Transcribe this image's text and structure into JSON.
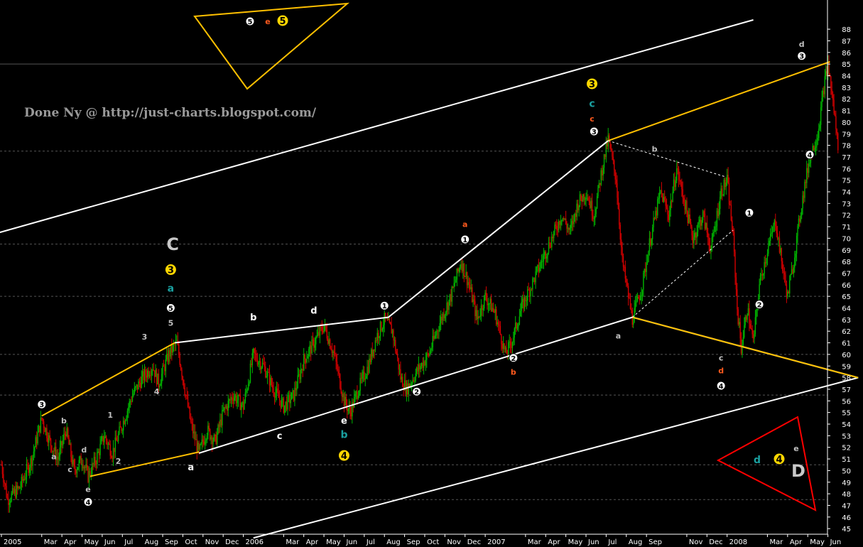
{
  "chart_data": {
    "type": "candlestick",
    "title": "",
    "xlabel": "",
    "ylabel": "",
    "ylim": [
      44,
      89
    ],
    "grid": false,
    "y_ticks": [
      45,
      46,
      47,
      48,
      49,
      50,
      51,
      52,
      53,
      54,
      55,
      56,
      57,
      58,
      59,
      60,
      61,
      62,
      63,
      64,
      65,
      66,
      67,
      68,
      69,
      70,
      71,
      72,
      73,
      74,
      75,
      76,
      77,
      78,
      79,
      80,
      81,
      82,
      83,
      84,
      85,
      86,
      87,
      88
    ],
    "x_labels": [
      {
        "label": "2005",
        "t": 0
      },
      {
        "label": "Mar",
        "t": 2
      },
      {
        "label": "Apr",
        "t": 3
      },
      {
        "label": "May",
        "t": 4
      },
      {
        "label": "Jun",
        "t": 5
      },
      {
        "label": "Jul",
        "t": 6
      },
      {
        "label": "Aug",
        "t": 7
      },
      {
        "label": "Sep",
        "t": 8
      },
      {
        "label": "Oct",
        "t": 9
      },
      {
        "label": "Nov",
        "t": 10
      },
      {
        "label": "Dec",
        "t": 11
      },
      {
        "label": "2006",
        "t": 12
      },
      {
        "label": "Mar",
        "t": 14
      },
      {
        "label": "Apr",
        "t": 15
      },
      {
        "label": "May",
        "t": 16
      },
      {
        "label": "Jun",
        "t": 17
      },
      {
        "label": "Jul",
        "t": 18
      },
      {
        "label": "Aug",
        "t": 19
      },
      {
        "label": "Sep",
        "t": 20
      },
      {
        "label": "Oct",
        "t": 21
      },
      {
        "label": "Nov",
        "t": 22
      },
      {
        "label": "Dec",
        "t": 23
      },
      {
        "label": "2007",
        "t": 24
      },
      {
        "label": "Mar",
        "t": 26
      },
      {
        "label": "Apr",
        "t": 27
      },
      {
        "label": "May",
        "t": 28
      },
      {
        "label": "Jun",
        "t": 29
      },
      {
        "label": "Jul",
        "t": 30
      },
      {
        "label": "Aug",
        "t": 31
      },
      {
        "label": "Sep",
        "t": 32
      },
      {
        "label": "Nov",
        "t": 34
      },
      {
        "label": "Dec",
        "t": 35
      },
      {
        "label": "2008",
        "t": 36
      },
      {
        "label": "Mar",
        "t": 38
      },
      {
        "label": "Apr",
        "t": 39
      },
      {
        "label": "May",
        "t": 40
      },
      {
        "label": "Jun",
        "t": 41
      }
    ],
    "price_path": [
      {
        "t": 0,
        "v": 50.5
      },
      {
        "t": 0.3,
        "v": 47.5
      },
      {
        "t": 0.9,
        "v": 48.5
      },
      {
        "t": 1.5,
        "v": 51
      },
      {
        "t": 2,
        "v": 54.5
      },
      {
        "t": 2.4,
        "v": 52.5
      },
      {
        "t": 2.8,
        "v": 51
      },
      {
        "t": 3.2,
        "v": 53.5
      },
      {
        "t": 3.6,
        "v": 50
      },
      {
        "t": 4,
        "v": 51
      },
      {
        "t": 4.3,
        "v": 49.5
      },
      {
        "t": 4.7,
        "v": 51
      },
      {
        "t": 5.1,
        "v": 53
      },
      {
        "t": 5.5,
        "v": 51.5
      },
      {
        "t": 6,
        "v": 54
      },
      {
        "t": 6.5,
        "v": 56.5
      },
      {
        "t": 7,
        "v": 58
      },
      {
        "t": 7.5,
        "v": 59
      },
      {
        "t": 7.8,
        "v": 57.5
      },
      {
        "t": 8.3,
        "v": 60
      },
      {
        "t": 8.7,
        "v": 61
      },
      {
        "t": 9,
        "v": 58
      },
      {
        "t": 9.4,
        "v": 54
      },
      {
        "t": 9.8,
        "v": 51.5
      },
      {
        "t": 10.2,
        "v": 53.5
      },
      {
        "t": 10.6,
        "v": 52.5
      },
      {
        "t": 11,
        "v": 55
      },
      {
        "t": 11.5,
        "v": 56.5
      },
      {
        "t": 12,
        "v": 55.5
      },
      {
        "t": 12.5,
        "v": 60
      },
      {
        "t": 13,
        "v": 59
      },
      {
        "t": 13.5,
        "v": 57
      },
      {
        "t": 14,
        "v": 55.5
      },
      {
        "t": 14.5,
        "v": 56.5
      },
      {
        "t": 15,
        "v": 59.5
      },
      {
        "t": 15.5,
        "v": 61
      },
      {
        "t": 16,
        "v": 62.5
      },
      {
        "t": 16.5,
        "v": 60
      },
      {
        "t": 17,
        "v": 56
      },
      {
        "t": 17.3,
        "v": 55
      },
      {
        "t": 17.7,
        "v": 57
      },
      {
        "t": 18.2,
        "v": 59
      },
      {
        "t": 18.6,
        "v": 61.5
      },
      {
        "t": 19,
        "v": 63
      },
      {
        "t": 19.4,
        "v": 62
      },
      {
        "t": 19.8,
        "v": 58
      },
      {
        "t": 20.1,
        "v": 57
      },
      {
        "t": 20.6,
        "v": 58.5
      },
      {
        "t": 21.2,
        "v": 60
      },
      {
        "t": 21.8,
        "v": 63
      },
      {
        "t": 22.3,
        "v": 65
      },
      {
        "t": 22.8,
        "v": 68
      },
      {
        "t": 23.2,
        "v": 66
      },
      {
        "t": 23.6,
        "v": 63
      },
      {
        "t": 24,
        "v": 65
      },
      {
        "t": 24.5,
        "v": 63.5
      },
      {
        "t": 25,
        "v": 60
      },
      {
        "t": 25.3,
        "v": 61
      },
      {
        "t": 25.8,
        "v": 64
      },
      {
        "t": 26.3,
        "v": 66
      },
      {
        "t": 26.8,
        "v": 68
      },
      {
        "t": 27.3,
        "v": 70
      },
      {
        "t": 27.8,
        "v": 72
      },
      {
        "t": 28.2,
        "v": 70.5
      },
      {
        "t": 28.6,
        "v": 73
      },
      {
        "t": 29,
        "v": 74
      },
      {
        "t": 29.4,
        "v": 72
      },
      {
        "t": 29.8,
        "v": 76
      },
      {
        "t": 30.1,
        "v": 78.5
      },
      {
        "t": 30.5,
        "v": 75
      },
      {
        "t": 30.8,
        "v": 68
      },
      {
        "t": 31.1,
        "v": 65
      },
      {
        "t": 31.3,
        "v": 63
      },
      {
        "t": 31.8,
        "v": 66
      },
      {
        "t": 32.2,
        "v": 70
      },
      {
        "t": 32.7,
        "v": 74
      },
      {
        "t": 33.1,
        "v": 72
      },
      {
        "t": 33.5,
        "v": 76
      },
      {
        "t": 33.9,
        "v": 73
      },
      {
        "t": 34.3,
        "v": 70
      },
      {
        "t": 34.8,
        "v": 72
      },
      {
        "t": 35.2,
        "v": 69
      },
      {
        "t": 35.7,
        "v": 74
      },
      {
        "t": 36,
        "v": 75
      },
      {
        "t": 36.3,
        "v": 70
      },
      {
        "t": 36.5,
        "v": 64
      },
      {
        "t": 36.7,
        "v": 60.5
      },
      {
        "t": 37,
        "v": 64
      },
      {
        "t": 37.3,
        "v": 61
      },
      {
        "t": 37.6,
        "v": 66
      },
      {
        "t": 38,
        "v": 69
      },
      {
        "t": 38.4,
        "v": 71.5
      },
      {
        "t": 38.7,
        "v": 68
      },
      {
        "t": 39,
        "v": 65
      },
      {
        "t": 39.3,
        "v": 68
      },
      {
        "t": 39.7,
        "v": 73
      },
      {
        "t": 40.1,
        "v": 77
      },
      {
        "t": 40.5,
        "v": 79
      },
      {
        "t": 40.8,
        "v": 83
      },
      {
        "t": 41,
        "v": 85
      },
      {
        "t": 41.3,
        "v": 81
      },
      {
        "t": 41.5,
        "v": 78
      }
    ],
    "horizontal_levels": [
      47.5,
      50.5,
      56.5,
      60,
      65,
      69.5,
      77.5,
      85
    ],
    "overlay_lines": [
      {
        "name": "upper-channel",
        "color": "#ffffff",
        "pts": [
          [
            -0.5,
            70.3
          ],
          [
            37.3,
            88.8
          ]
        ]
      },
      {
        "name": "lower-channel",
        "color": "#ffffff",
        "pts": [
          [
            12.5,
            44.2
          ],
          [
            42.5,
            58
          ]
        ]
      },
      {
        "name": "mid-channel",
        "color": "#ffffff",
        "pts": [
          [
            9.8,
            51.5
          ],
          [
            31.3,
            63.2
          ],
          [
            42.5,
            58
          ]
        ]
      },
      {
        "name": "wave-c-top",
        "color": "#ffffff",
        "pts": [
          [
            8.6,
            61
          ],
          [
            19.2,
            63.2
          ],
          [
            30.1,
            78.4
          ]
        ]
      },
      {
        "name": "yellow-upper",
        "color": "#ffc000",
        "pts": [
          [
            2,
            54.7
          ],
          [
            8.6,
            61
          ]
        ]
      },
      {
        "name": "yellow-lower",
        "color": "#ffc000",
        "pts": [
          [
            4.4,
            49.5
          ],
          [
            9.8,
            51.6
          ]
        ]
      },
      {
        "name": "yellow-top",
        "color": "#ffc000",
        "pts": [
          [
            30.1,
            78.4
          ],
          [
            41.1,
            85.2
          ]
        ]
      },
      {
        "name": "yellow-bottom",
        "color": "#ffc000",
        "pts": [
          [
            31.3,
            63.2
          ],
          [
            42.5,
            58
          ]
        ]
      }
    ],
    "dashed_lines": [
      {
        "name": "b-d-dashed",
        "color": "#ffffff",
        "pts": [
          [
            30.1,
            78.4
          ],
          [
            35.9,
            75.3
          ]
        ]
      },
      {
        "name": "a-c-dashed",
        "color": "#ffffff",
        "pts": [
          [
            31.3,
            63.2
          ],
          [
            36.3,
            70.7
          ]
        ]
      }
    ],
    "wave_labels": [
      {
        "text": "3",
        "circle": true,
        "fill": "#ffffff",
        "t": 2,
        "v": 55.7
      },
      {
        "text": "b",
        "t": 3.1,
        "v": 54.3,
        "color": "#c0c0c0"
      },
      {
        "text": "a",
        "t": 2.6,
        "v": 51.2,
        "color": "#c0c0c0"
      },
      {
        "text": "c",
        "t": 3.4,
        "v": 50.1,
        "color": "#c0c0c0"
      },
      {
        "text": "d",
        "t": 4.1,
        "v": 51.8,
        "color": "#c0c0c0"
      },
      {
        "text": "e",
        "t": 4.3,
        "v": 48.4,
        "color": "#c0c0c0"
      },
      {
        "text": "4",
        "circle": true,
        "fill": "#ffffff",
        "t": 4.3,
        "v": 47.3
      },
      {
        "text": "1",
        "t": 5.4,
        "v": 54.8,
        "color": "#c0c0c0"
      },
      {
        "text": "2",
        "t": 5.8,
        "v": 50.8,
        "color": "#c0c0c0"
      },
      {
        "text": "3",
        "t": 7.1,
        "v": 61.5,
        "color": "#c0c0c0"
      },
      {
        "text": "4",
        "t": 7.7,
        "v": 56.8,
        "color": "#c0c0c0"
      },
      {
        "text": "5",
        "t": 8.4,
        "v": 62.7,
        "color": "#c0c0c0"
      },
      {
        "text": "5",
        "circle": true,
        "fill": "#ffffff",
        "t": 8.4,
        "v": 64
      },
      {
        "text": "a",
        "t": 8.4,
        "v": 65.7,
        "color": "#1aa0a0",
        "size": 14
      },
      {
        "text": "3",
        "circle": true,
        "fill": "#ffd700",
        "t": 8.4,
        "v": 67.3,
        "big": true
      },
      {
        "text": "C",
        "t": 8.5,
        "v": 69.5,
        "color": "#c8c8c8",
        "size": 24
      },
      {
        "text": "a",
        "t": 9.4,
        "v": 50.3,
        "color": "#ffffff",
        "size": 13
      },
      {
        "text": "b",
        "t": 12.5,
        "v": 63.2,
        "color": "#ffffff",
        "size": 13
      },
      {
        "text": "c",
        "t": 13.8,
        "v": 53,
        "color": "#ffffff",
        "size": 13
      },
      {
        "text": "d",
        "t": 15.5,
        "v": 63.8,
        "color": "#ffffff",
        "size": 13
      },
      {
        "text": "e",
        "t": 17,
        "v": 54.3,
        "color": "#ffffff",
        "size": 13
      },
      {
        "text": "b",
        "t": 17,
        "v": 53.1,
        "color": "#1aa0a0",
        "size": 14
      },
      {
        "text": "4",
        "circle": true,
        "fill": "#ffd700",
        "t": 17,
        "v": 51.3,
        "big": true
      },
      {
        "text": "1",
        "circle": true,
        "fill": "#ffffff",
        "t": 19,
        "v": 64.2
      },
      {
        "text": "2",
        "circle": true,
        "fill": "#ffffff",
        "t": 20.6,
        "v": 56.8
      },
      {
        "text": "a",
        "t": 23,
        "v": 71.2,
        "color": "#ff5a1e",
        "size": 11
      },
      {
        "text": "1",
        "circle": true,
        "fill": "#ffffff",
        "t": 23,
        "v": 69.9
      },
      {
        "text": "2",
        "circle": true,
        "fill": "#ffffff",
        "t": 25.4,
        "v": 59.7
      },
      {
        "text": "b",
        "t": 25.4,
        "v": 58.5,
        "color": "#ff5a1e",
        "size": 11
      },
      {
        "text": "3",
        "circle": true,
        "fill": "#ffd700",
        "t": 29.3,
        "v": 83.3,
        "big": true
      },
      {
        "text": "c",
        "t": 29.3,
        "v": 81.6,
        "color": "#1aa0a0",
        "size": 14
      },
      {
        "text": "c",
        "t": 29.3,
        "v": 80.3,
        "color": "#ff5a1e",
        "size": 11
      },
      {
        "text": "3",
        "circle": true,
        "fill": "#ffffff",
        "t": 29.4,
        "v": 79.2
      },
      {
        "text": "b",
        "t": 32.4,
        "v": 77.7,
        "color": "#c0c0c0"
      },
      {
        "text": "a",
        "t": 30.6,
        "v": 61.6,
        "color": "#c0c0c0"
      },
      {
        "text": "c",
        "t": 35.7,
        "v": 59.7,
        "color": "#c0c0c0"
      },
      {
        "text": "d",
        "t": 35.7,
        "v": 58.6,
        "color": "#ff5a1e",
        "size": 11
      },
      {
        "text": "4",
        "circle": true,
        "fill": "#ffffff",
        "t": 35.7,
        "v": 57.3
      },
      {
        "text": "1",
        "circle": true,
        "fill": "#ffffff",
        "t": 37.1,
        "v": 72.2
      },
      {
        "text": "2",
        "circle": true,
        "fill": "#ffffff",
        "t": 37.6,
        "v": 64.3
      },
      {
        "text": "d",
        "t": 39.7,
        "v": 86.7,
        "color": "#c0c0c0"
      },
      {
        "text": "3",
        "circle": true,
        "fill": "#ffffff",
        "t": 39.7,
        "v": 85.7
      },
      {
        "text": "4",
        "circle": true,
        "fill": "#ffffff",
        "t": 40.1,
        "v": 77.2
      }
    ],
    "watermark": "Done Ny @ http://just-charts.blogspot.com/",
    "legend_triangles": [
      {
        "name": "yellow-triangle",
        "color": "#ffc000",
        "labels": [
          {
            "text": "5",
            "circle": true,
            "fill": "#ffffff"
          },
          {
            "text": "e",
            "color": "#ff5a1e"
          },
          {
            "text": "5",
            "circle": true,
            "fill": "#ffd700",
            "big": true
          }
        ]
      },
      {
        "name": "red-triangle",
        "color": "#ff0000",
        "labels": [
          {
            "text": "d",
            "color": "#1aa0a0"
          },
          {
            "text": "4",
            "circle": true,
            "fill": "#ffd700",
            "big": true
          },
          {
            "text": "e",
            "color": "#c0c0c0"
          },
          {
            "text": "D",
            "color": "#c8c8c8"
          }
        ]
      }
    ],
    "colors": {
      "background": "#000000",
      "up_candle": "#00b400",
      "down_candle": "#d20000",
      "axis": "#ffffff",
      "level_line": "#555555"
    }
  }
}
